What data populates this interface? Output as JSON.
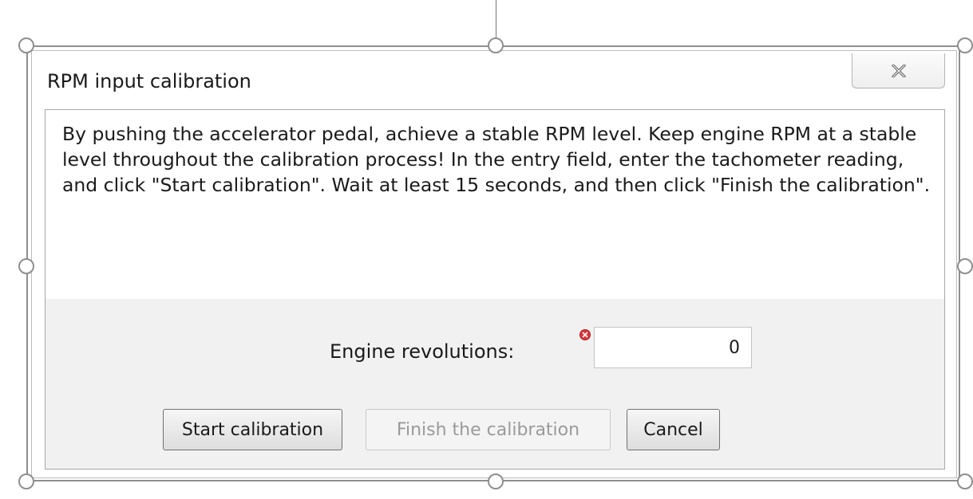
{
  "dialog": {
    "title": "RPM input calibration",
    "close_icon": "close-icon",
    "instructions": "By pushing the accelerator pedal, achieve a stable RPM level. Keep engine RPM at a stable level throughout the calibration process! In the entry field, enter the tachometer reading, and click \"Start calibration\". Wait at least 15 seconds, and then click  \"Finish the calibration\"."
  },
  "form": {
    "rpm_label": "Engine revolutions:",
    "rpm_value": "0",
    "error_icon": "error-icon",
    "error_color": "#d9373b"
  },
  "buttons": {
    "start_label": "Start calibration",
    "finish_label": "Finish the calibration",
    "finish_enabled": false,
    "cancel_label": "Cancel"
  }
}
